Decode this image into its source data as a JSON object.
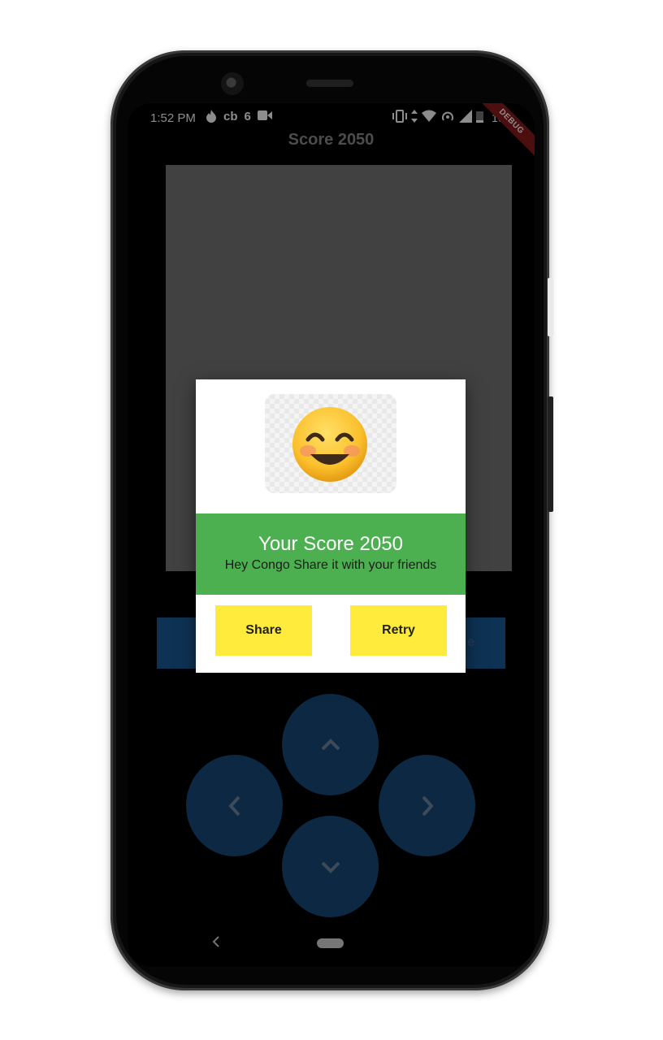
{
  "status_bar": {
    "time": "1:52 PM",
    "left_icons": [
      "flame-icon",
      "cb",
      "6",
      "video-icon"
    ],
    "right_icons": [
      "vibrate-icon",
      "data-icon",
      "wifi-icon",
      "hotspot-icon",
      "signal-icon",
      "battery-icon"
    ],
    "battery": "10%"
  },
  "debug_banner": "DEBUG",
  "app_bar": {
    "title": "Score 2050"
  },
  "background_button": {
    "label": "e"
  },
  "dialog": {
    "emoji": "😊",
    "score_title": "Your Score 2050",
    "message": "Hey Congo Share it with your friends",
    "share_label": "Share",
    "retry_label": "Retry"
  },
  "dpad": {
    "up": "chevron-up-icon",
    "left": "chevron-left-icon",
    "right": "chevron-right-icon",
    "down": "chevron-down-icon"
  },
  "colors": {
    "green": "#4caf50",
    "yellow": "#ffeb3b",
    "dpad_blue": "#164a79",
    "game_area": "#777777"
  }
}
